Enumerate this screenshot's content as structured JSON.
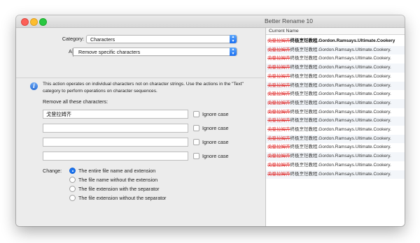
{
  "window": {
    "title": "Better Rename 10"
  },
  "left": {
    "category_label": "Category:",
    "category_value": "Characters",
    "action_label": "Action:",
    "action_value": "Remove specific characters",
    "info_text": "This action operates on individual characters not on character strings. Use the actions in the \"Text\" category to perform operations on character sequences.",
    "section_title": "Remove all these characters:",
    "fields": [
      {
        "value": "戈登拉姆齐",
        "ignore_case_label": "Ignore case"
      },
      {
        "value": "",
        "ignore_case_label": "Ignore case"
      },
      {
        "value": "",
        "ignore_case_label": "Ignore case"
      },
      {
        "value": "",
        "ignore_case_label": "Ignore case"
      }
    ],
    "change_label": "Change:",
    "change_options": [
      {
        "label": "The entire file name and extension",
        "selected": true
      },
      {
        "label": "The file name without the extension",
        "selected": false
      },
      {
        "label": "The file extension with the separator",
        "selected": false
      },
      {
        "label": "The file extension without the separator",
        "selected": false
      }
    ]
  },
  "right": {
    "column_header": "Current Name",
    "rows": [
      {
        "removed": "戈登拉姆齐",
        "rest": "终极烹饪教程.Gordon.Ramsays.Ultimate.Cookery"
      },
      {
        "removed": "戈登拉姆齐",
        "rest": "终极烹饪教程.Gordon.Ramsays.Ultimate.Cookery."
      },
      {
        "removed": "戈登拉姆齐",
        "rest": "终极烹饪教程.Gordon.Ramsays.Ultimate.Cookery."
      },
      {
        "removed": "戈登拉姆齐",
        "rest": "终极烹饪教程.Gordon.Ramsays.Ultimate.Cookery."
      },
      {
        "removed": "戈登拉姆齐",
        "rest": "终极烹饪教程.Gordon.Ramsays.Ultimate.Cookery."
      },
      {
        "removed": "戈登拉姆齐",
        "rest": "终极烹饪教程.Gordon.Ramsays.Ultimate.Cookery."
      },
      {
        "removed": "戈登拉姆齐",
        "rest": "终极烹饪教程.Gordon.Ramsays.Ultimate.Cookery."
      },
      {
        "removed": "戈登拉姆齐",
        "rest": "终极烹饪教程.Gordon.Ramsays.Ultimate.Cookery."
      },
      {
        "removed": "戈登拉姆齐",
        "rest": "终极烹饪教程.Gordon.Ramsays.Ultimate.Cookery."
      },
      {
        "removed": "戈登拉姆齐",
        "rest": "终极烹饪教程.Gordon.Ramsays.Ultimate.Cookery."
      },
      {
        "removed": "戈登拉姆齐",
        "rest": "终极烹饪教程.Gordon.Ramsays.Ultimate.Cookery."
      },
      {
        "removed": "戈登拉姆齐",
        "rest": "终极烹饪教程.Gordon.Ramsays.Ultimate.Cookery."
      },
      {
        "removed": "戈登拉姆齐",
        "rest": "终极烹饪教程.Gordon.Ramsays.Ultimate.Cookery."
      },
      {
        "removed": "戈登拉姆齐",
        "rest": "终极烹饪教程.Gordon.Ramsays.Ultimate.Cookery."
      },
      {
        "removed": "戈登拉姆齐",
        "rest": "终极烹饪教程.Gordon.Ramsays.Ultimate.Cookery."
      },
      {
        "removed": "戈登拉姆齐",
        "rest": "终极烹饪教程.Gordon.Ramsays.Ultimate.Cookery."
      }
    ]
  },
  "colors": {
    "accent": "#1b74f0",
    "removed_text": "#e03030"
  },
  "icons": {
    "info": "info-icon",
    "popup_arrows": "up-down-chevron-icon"
  }
}
